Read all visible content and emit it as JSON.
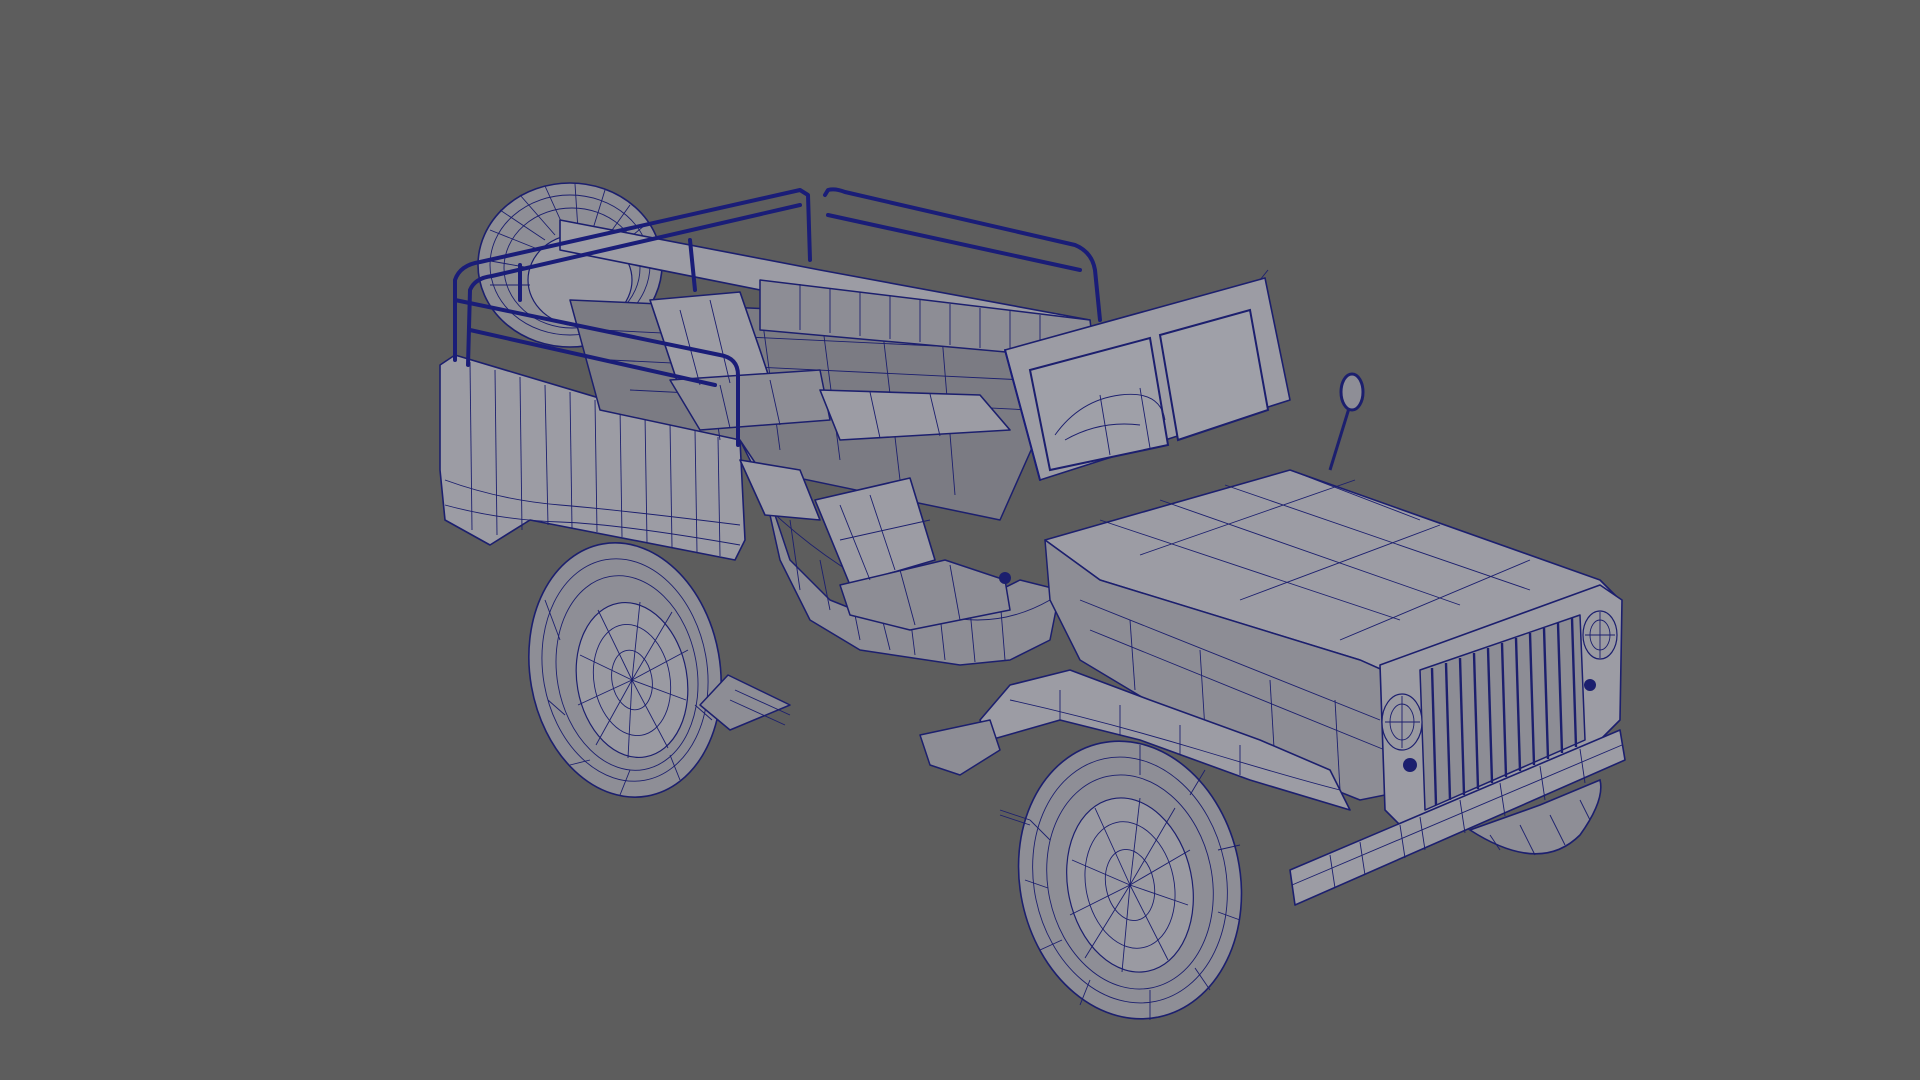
{
  "viewport": {
    "background": "#5d5d5d",
    "wireframe_color": "#1c1f6e",
    "object": "jeep-model-wireframe",
    "display_mode": "wireframe-on-shaded"
  }
}
